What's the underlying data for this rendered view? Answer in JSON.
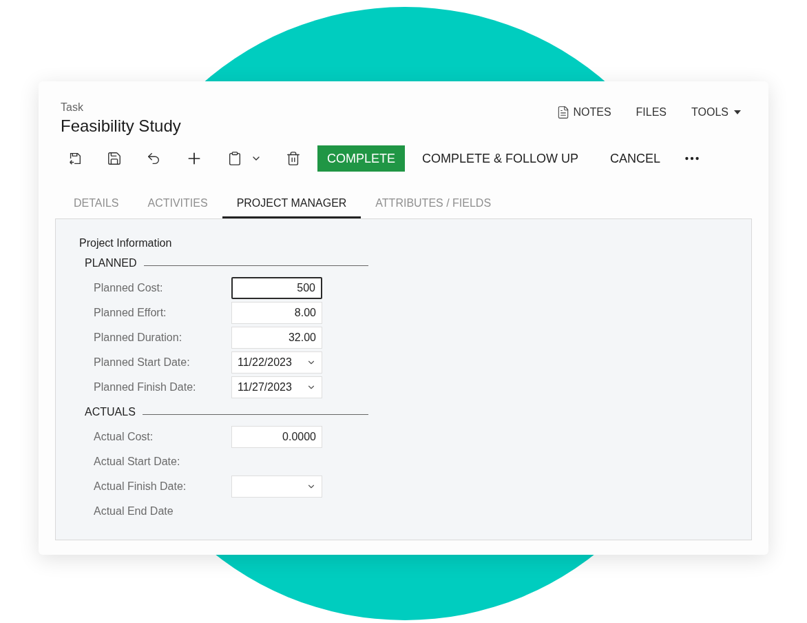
{
  "header": {
    "caption": "Task",
    "title": "Feasibility Study"
  },
  "top_links": [
    {
      "label": "NOTES",
      "kind": "notes"
    },
    {
      "label": "FILES",
      "kind": "plain"
    },
    {
      "label": "TOOLS",
      "kind": "dropdown"
    }
  ],
  "toolbar": {
    "icons": [
      {
        "kind": "save-close"
      },
      {
        "kind": "save"
      },
      {
        "kind": "undo"
      },
      {
        "kind": "add"
      },
      {
        "kind": "copy-paste"
      },
      {
        "kind": "delete"
      }
    ],
    "buttons": [
      {
        "label": "COMPLETE",
        "kind": "primary"
      },
      {
        "label": "COMPLETE & FOLLOW UP",
        "kind": "plain"
      },
      {
        "label": "CANCEL",
        "kind": "plain"
      }
    ]
  },
  "tabs": [
    {
      "label": "DETAILS",
      "selected": false
    },
    {
      "label": "ACTIVITIES",
      "selected": false
    },
    {
      "label": "PROJECT MANAGER",
      "selected": true
    },
    {
      "label": "ATTRIBUTES / FIELDS",
      "selected": false
    }
  ],
  "panel": {
    "title": "Project Information",
    "groups": [
      {
        "title": "PLANNED",
        "fields": [
          {
            "label": "Planned Cost:",
            "kind": "number",
            "value": "500",
            "focused": true
          },
          {
            "label": "Planned Effort:",
            "kind": "number",
            "value": "8.00",
            "focused": false
          },
          {
            "label": "Planned Duration:",
            "kind": "number",
            "value": "32.00",
            "focused": false
          },
          {
            "label": "Planned Start Date:",
            "kind": "date",
            "value": "11/22/2023",
            "focused": false
          },
          {
            "label": "Planned Finish Date:",
            "kind": "date",
            "value": "11/27/2023",
            "focused": false
          }
        ]
      },
      {
        "title": "ACTUALS",
        "fields": [
          {
            "label": "Actual Cost:",
            "kind": "number",
            "value": "0.0000",
            "focused": false
          },
          {
            "label": "Actual Start Date:",
            "kind": "none"
          },
          {
            "label": "Actual Finish Date:",
            "kind": "date",
            "focused": false
          },
          {
            "label": "Actual End Date",
            "kind": "none"
          }
        ]
      }
    ]
  }
}
